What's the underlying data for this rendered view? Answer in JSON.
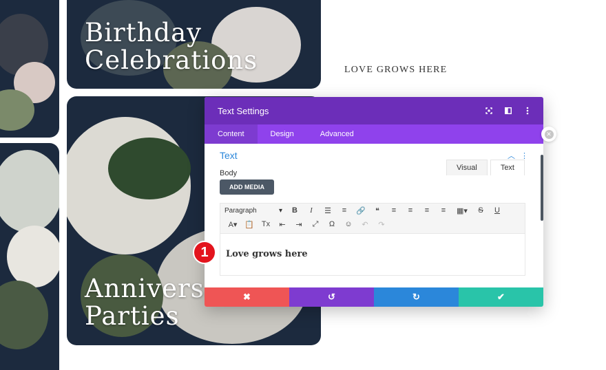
{
  "cards": {
    "birthday_title": "Birthday\nCelebrations",
    "anniversary_title": "Anniversary\nParties"
  },
  "tagline": "LOVE GROWS HERE",
  "modal": {
    "title": "Text Settings",
    "header_icons": [
      "fullscreen-icon",
      "split-view-icon",
      "more-options-icon"
    ],
    "tabs": [
      {
        "label": "Content",
        "active": true
      },
      {
        "label": "Design",
        "active": false
      },
      {
        "label": "Advanced",
        "active": false
      }
    ],
    "section": {
      "title": "Text",
      "body_label": "Body",
      "add_media_label": "ADD MEDIA",
      "editor_tabs": [
        "Visual",
        "Text"
      ],
      "format_select": "Paragraph",
      "toolbar_row1": [
        "B",
        "I",
        "☰",
        "≡",
        "🔗",
        "❝",
        "≡",
        "≡",
        "≡",
        "≡",
        "▦▾",
        "S",
        "U"
      ],
      "toolbar_row2": [
        "A▾",
        "📋",
        "Tx",
        "⇤",
        "⇥",
        "⤢",
        "Ω",
        "☺",
        "↶",
        "↷"
      ],
      "content": "Love grows here"
    },
    "footer": {
      "cancel": "✖",
      "undo": "↺",
      "redo": "↻",
      "save": "✔"
    },
    "colors": {
      "header": "#6c2eb9",
      "tabs": "#8f42ec",
      "cancel": "#ef5555",
      "undo": "#7e3bd0",
      "redo": "#2b87da",
      "save": "#29c4a9"
    }
  },
  "step_badge": "1"
}
